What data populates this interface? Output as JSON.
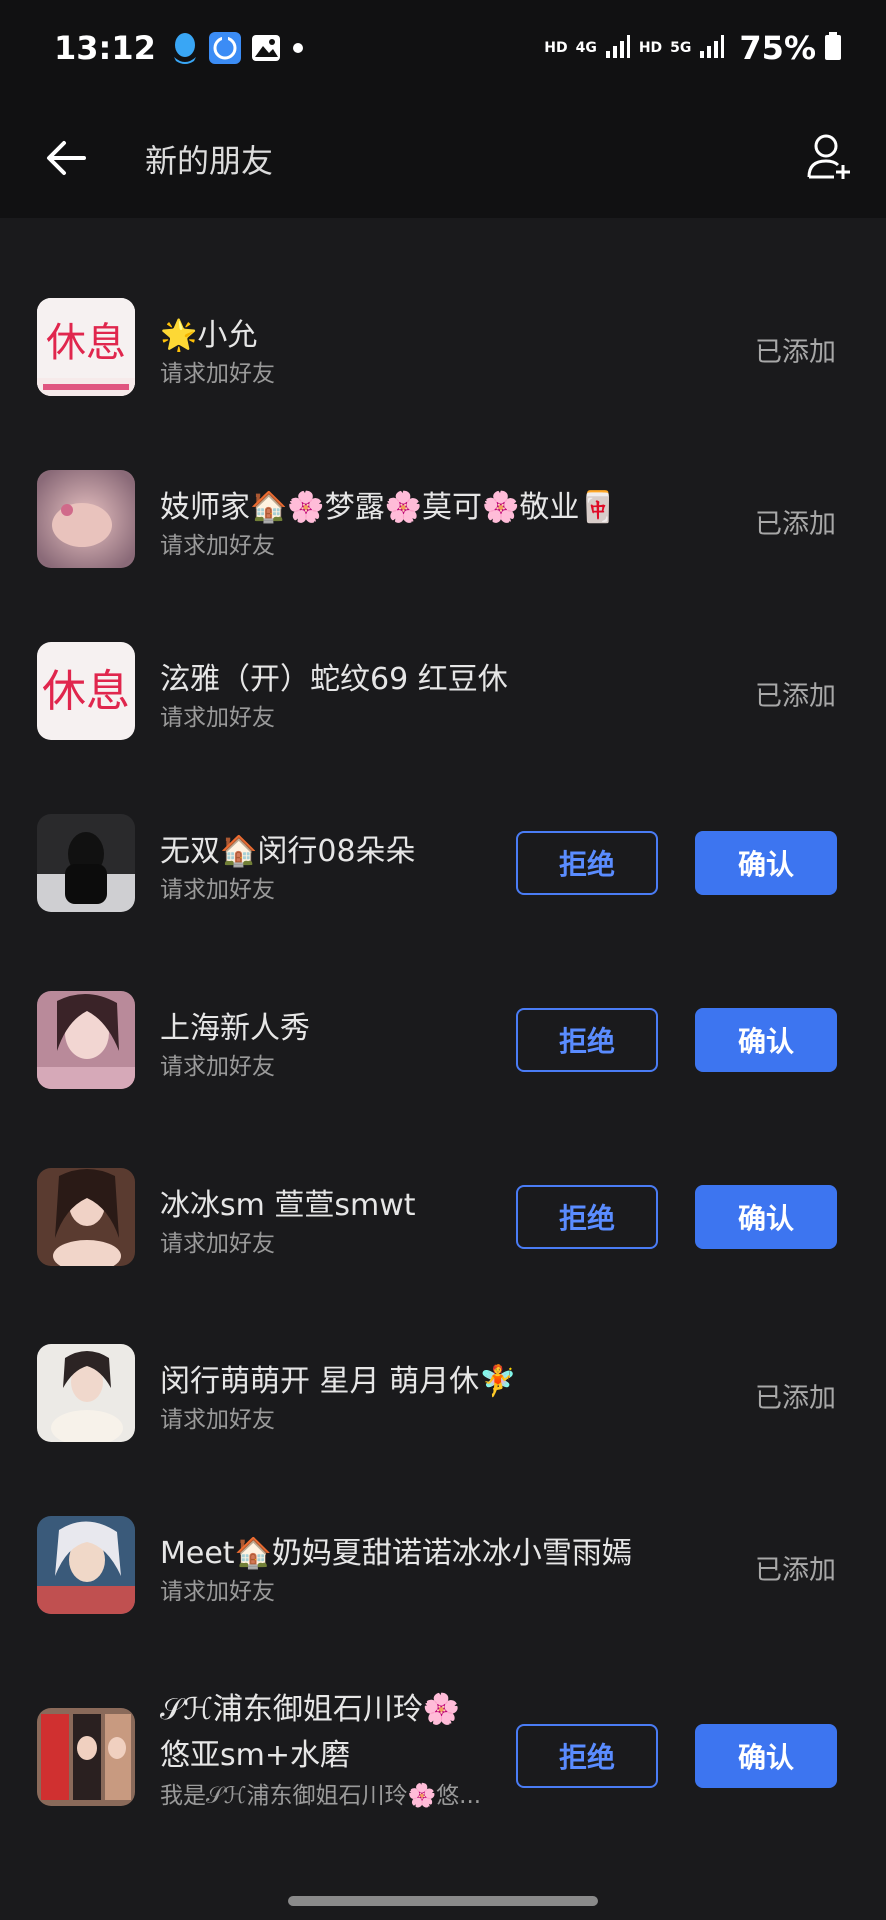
{
  "status_bar": {
    "time": "13:12",
    "hd1": "HD",
    "net4g": "4G",
    "hd2": "HD",
    "net5g": "5G",
    "battery": "75%"
  },
  "header": {
    "title": "新的朋友"
  },
  "accent_color": "#3d75f0",
  "requests": [
    {
      "name": "🌟小允",
      "subtitle": "请求加好友",
      "status": "已添加",
      "avatar_text": "休息"
    },
    {
      "name": "妓师家🏠🌸梦露🌸莫可🌸敬业🀄",
      "subtitle": "请求加好友",
      "status": "已添加"
    },
    {
      "name": "泫雅（开）蛇纹69 红豆休",
      "subtitle": "请求加好友",
      "status": "已添加",
      "avatar_text": "休息"
    },
    {
      "name": "无双🏠闵行08朵朵",
      "subtitle": "请求加好友",
      "reject_label": "拒绝",
      "confirm_label": "确认"
    },
    {
      "name": "上海新人秀",
      "subtitle": "请求加好友",
      "reject_label": "拒绝",
      "confirm_label": "确认"
    },
    {
      "name": "冰冰sm 萱萱smwt",
      "subtitle": "请求加好友",
      "reject_label": "拒绝",
      "confirm_label": "确认"
    },
    {
      "name": "闵行萌萌开 星月 萌月休🧚",
      "subtitle": "请求加好友",
      "status": "已添加"
    },
    {
      "name": "Meet🏠奶妈夏甜诺诺冰冰小雪雨嫣",
      "subtitle": "请求加好友",
      "status": "已添加"
    },
    {
      "name": "𝒮ℋ浦东御姐石川玲🌸",
      "name_line2": "悠亚sm+水磨",
      "subtitle": "我是𝒮ℋ浦东御姐石川玲🌸悠...",
      "reject_label": "拒绝",
      "confirm_label": "确认"
    }
  ]
}
